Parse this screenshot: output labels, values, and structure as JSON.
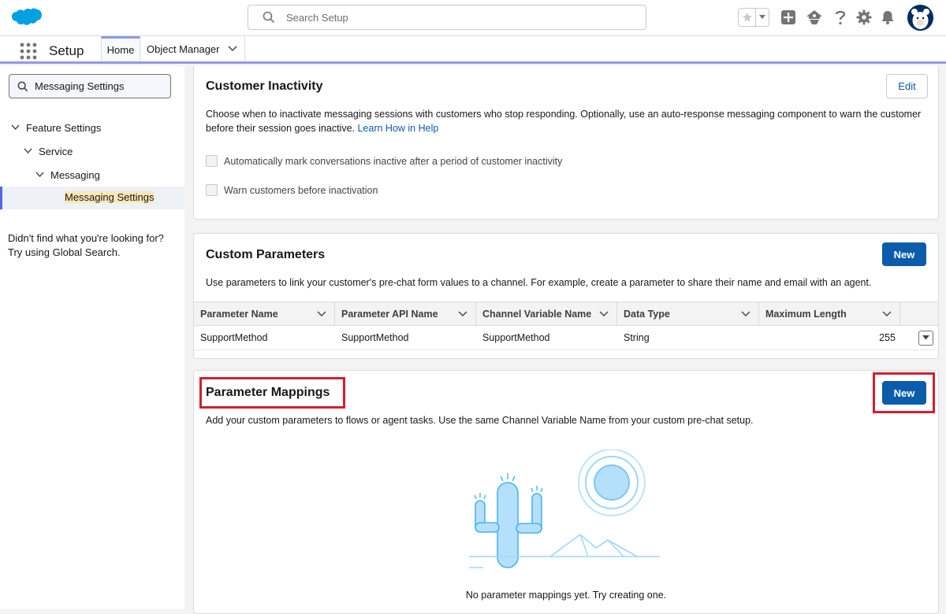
{
  "header": {
    "search_placeholder": "Search Setup"
  },
  "nav": {
    "app_name": "Setup",
    "tabs": [
      {
        "label": "Home"
      },
      {
        "label": "Object Manager"
      }
    ]
  },
  "sidebar": {
    "quick_find_value": "Messaging Settings",
    "tree": [
      {
        "label": "Feature Settings"
      },
      {
        "label": "Service"
      },
      {
        "label": "Messaging"
      },
      {
        "label": "Messaging Settings"
      }
    ],
    "not_found_text": "Didn't find what you're looking for? Try using Global Search."
  },
  "customer_inactivity": {
    "title": "Customer Inactivity",
    "edit_label": "Edit",
    "description": "Choose when to inactivate messaging sessions with customers who stop responding. Optionally, use an auto-response messaging component to warn the customer before their session goes inactive.",
    "learn_link": "Learn How in Help",
    "checkboxes": [
      {
        "label": "Automatically mark conversations inactive after a period of customer inactivity",
        "checked": false
      },
      {
        "label": "Warn customers before inactivation",
        "checked": false
      }
    ]
  },
  "custom_parameters": {
    "title": "Custom Parameters",
    "new_label": "New",
    "description": "Use parameters to link your customer's pre-chat form values to a channel. For example, create a parameter to share their name and email with an agent.",
    "columns": [
      "Parameter Name",
      "Parameter API Name",
      "Channel Variable Name",
      "Data Type",
      "Maximum Length"
    ],
    "rows": [
      {
        "name": "SupportMethod",
        "api_name": "SupportMethod",
        "channel_variable": "SupportMethod",
        "data_type": "String",
        "max_length": "255"
      }
    ]
  },
  "parameter_mappings": {
    "title": "Parameter Mappings",
    "new_label": "New",
    "description": "Add your custom parameters to flows or agent tasks. Use the same Channel Variable Name from your custom pre-chat setup.",
    "empty_text": "No parameter mappings yet. Try creating one."
  },
  "colors": {
    "brand": "#0b5cab",
    "highlight": "#d0202f",
    "nav_accent": "#8e9ce8"
  }
}
